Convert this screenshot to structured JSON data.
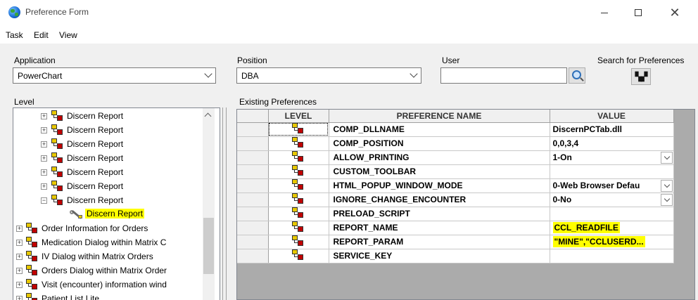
{
  "window": {
    "title": "Preference Form"
  },
  "menu": {
    "items": [
      "Task",
      "Edit",
      "View"
    ]
  },
  "application": {
    "label": "Application",
    "value": "PowerChart"
  },
  "position": {
    "label": "Position",
    "value": "DBA"
  },
  "user": {
    "label": "User",
    "value": ""
  },
  "search": {
    "label": "Search for Preferences"
  },
  "level_panel": {
    "label": "Level",
    "tree": [
      {
        "label": "Discern Report",
        "indent": 1,
        "expander": "+"
      },
      {
        "label": "Discern Report",
        "indent": 1,
        "expander": "+"
      },
      {
        "label": "Discern Report",
        "indent": 1,
        "expander": "+"
      },
      {
        "label": "Discern Report",
        "indent": 1,
        "expander": "+"
      },
      {
        "label": "Discern Report",
        "indent": 1,
        "expander": "+"
      },
      {
        "label": "Discern Report",
        "indent": 1,
        "expander": "+"
      },
      {
        "label": "Discern Report",
        "indent": 1,
        "expander": "-"
      },
      {
        "label": "Discern Report",
        "indent": 2,
        "expander": "",
        "selected": true,
        "icon": "wrench-report-icon"
      },
      {
        "label": "Order Information for Orders",
        "indent": 0,
        "expander": "+"
      },
      {
        "label": "Medication Dialog within Matrix C",
        "indent": 0,
        "expander": "+"
      },
      {
        "label": "IV Dialog within Matrix Orders",
        "indent": 0,
        "expander": "+"
      },
      {
        "label": "Orders Dialog within Matrix Order",
        "indent": 0,
        "expander": "+"
      },
      {
        "label": "Visit (encounter) information wind",
        "indent": 0,
        "expander": "+"
      },
      {
        "label": "Patient List Lite",
        "indent": 0,
        "expander": "+"
      }
    ]
  },
  "existing": {
    "label": "Existing Preferences",
    "columns": [
      "LEVEL",
      "PREFERENCE NAME",
      "VALUE"
    ],
    "rows": [
      {
        "name": "COMP_DLLNAME",
        "value": "DiscernPCTab.dll",
        "dropdown": false,
        "highlight": false
      },
      {
        "name": "COMP_POSITION",
        "value": "0,0,3,4",
        "dropdown": false,
        "highlight": false
      },
      {
        "name": "ALLOW_PRINTING",
        "value": "1-On",
        "dropdown": true,
        "highlight": false
      },
      {
        "name": "CUSTOM_TOOLBAR",
        "value": "",
        "dropdown": false,
        "highlight": false
      },
      {
        "name": "HTML_POPUP_WINDOW_MODE",
        "value": "0-Web Browser Defau",
        "dropdown": true,
        "highlight": false
      },
      {
        "name": "IGNORE_CHANGE_ENCOUNTER",
        "value": "0-No",
        "dropdown": true,
        "highlight": false
      },
      {
        "name": "PRELOAD_SCRIPT",
        "value": "",
        "dropdown": false,
        "highlight": false
      },
      {
        "name": "REPORT_NAME",
        "value": "CCL_READFILE",
        "dropdown": false,
        "highlight": true
      },
      {
        "name": "REPORT_PARAM",
        "value": "\"MINE\",\"CCLUSERD...",
        "dropdown": false,
        "highlight": true
      },
      {
        "name": "SERVICE_KEY",
        "value": "",
        "dropdown": false,
        "highlight": false
      }
    ]
  },
  "colors": {
    "highlight": "#ffff00",
    "grid_empty": "#ababab"
  }
}
